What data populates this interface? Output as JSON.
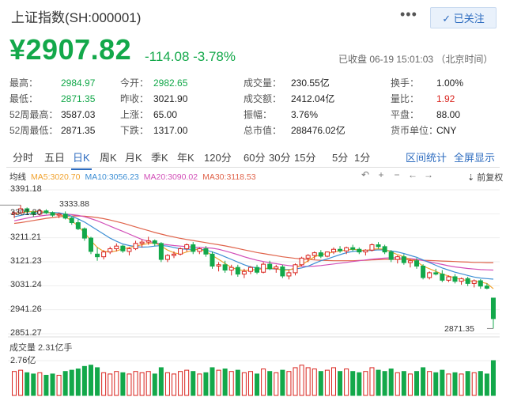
{
  "header": {
    "title": "上证指数(SH:000001)",
    "more_label": "•••",
    "follow_label": "✓ 已关注"
  },
  "quote": {
    "price": "¥2907.82",
    "change": "-114.08",
    "change_pct": "-3.78%",
    "status": "已收盘 06-19 15:01:03 （北京时间）"
  },
  "stats": [
    {
      "label": "最高：",
      "value": "2984.97",
      "tone": "green"
    },
    {
      "label": "今开：",
      "value": "2982.65",
      "tone": "green"
    },
    {
      "label": "成交量：",
      "value": "230.55亿",
      "tone": "default"
    },
    {
      "label": "换手：",
      "value": "1.00%",
      "tone": "default"
    },
    {
      "label": "最低：",
      "value": "2871.35",
      "tone": "green"
    },
    {
      "label": "昨收：",
      "value": "3021.90",
      "tone": "default"
    },
    {
      "label": "成交额：",
      "value": "2412.04亿",
      "tone": "default"
    },
    {
      "label": "量比：",
      "value": "1.92",
      "tone": "red"
    },
    {
      "label": "52周最高：",
      "value": "3587.03",
      "tone": "default"
    },
    {
      "label": "上涨：",
      "value": "65.00",
      "tone": "default"
    },
    {
      "label": "振幅：",
      "value": "3.76%",
      "tone": "default"
    },
    {
      "label": "平盘：",
      "value": "88.00",
      "tone": "default"
    },
    {
      "label": "52周最低：",
      "value": "2871.35",
      "tone": "default"
    },
    {
      "label": "下跌：",
      "value": "1317.00",
      "tone": "default"
    },
    {
      "label": "总市值：",
      "value": "288476.02亿",
      "tone": "default"
    },
    {
      "label": "货币单位：",
      "value": "CNY",
      "tone": "default"
    }
  ],
  "tabs": [
    "分时",
    "五日",
    "日K",
    "周K",
    "月K",
    "季K",
    "年K",
    "120分",
    "60分",
    "30分",
    "15分",
    "5分",
    "1分"
  ],
  "active_tab": "日K",
  "right_tabs": [
    "区间统计",
    "全屏显示"
  ],
  "ma_legend": [
    {
      "label": "均线",
      "color": "#333333"
    },
    {
      "label": "MA5:3020.70",
      "color": "#f0a22e"
    },
    {
      "label": "MA10:3056.23",
      "color": "#3c8ed4"
    },
    {
      "label": "MA20:3090.02",
      "color": "#d24fb8"
    },
    {
      "label": "MA30:3118.53",
      "color": "#e0634a"
    }
  ],
  "chart_controls": [
    "↶",
    "+",
    "−",
    "←",
    "→"
  ],
  "restore_label": "前复权",
  "chart_data": {
    "type": "candlestick",
    "y_ticks": [
      "3391.18",
      "3301.20",
      "3211.21",
      "3121.23",
      "3031.24",
      "2941.26",
      "2851.27"
    ],
    "ylim": [
      2851.27,
      3391.18
    ],
    "max_label": "3333.88",
    "min_label": "2871.35",
    "volume_title": "成交量 2.31亿手",
    "volume_max_label": "2.76亿",
    "up_color": "#d9241e",
    "down_color": "#13a84a",
    "candles": [
      [
        3300,
        3310,
        3285,
        3305
      ],
      [
        3305,
        3334,
        3300,
        3320
      ],
      [
        3320,
        3325,
        3300,
        3310
      ],
      [
        3308,
        3312,
        3290,
        3300
      ],
      [
        3300,
        3320,
        3295,
        3312
      ],
      [
        3312,
        3318,
        3300,
        3305
      ],
      [
        3305,
        3310,
        3290,
        3296
      ],
      [
        3296,
        3305,
        3285,
        3300
      ],
      [
        3300,
        3310,
        3280,
        3285
      ],
      [
        3285,
        3290,
        3260,
        3268
      ],
      [
        3268,
        3280,
        3240,
        3245
      ],
      [
        3245,
        3250,
        3200,
        3210
      ],
      [
        3210,
        3215,
        3150,
        3160
      ],
      [
        3150,
        3175,
        3125,
        3140
      ],
      [
        3140,
        3165,
        3130,
        3158
      ],
      [
        3158,
        3178,
        3150,
        3170
      ],
      [
        3170,
        3190,
        3160,
        3180
      ],
      [
        3180,
        3185,
        3155,
        3162
      ],
      [
        3160,
        3175,
        3145,
        3170
      ],
      [
        3170,
        3200,
        3165,
        3190
      ],
      [
        3190,
        3205,
        3175,
        3195
      ],
      [
        3195,
        3215,
        3185,
        3200
      ],
      [
        3200,
        3205,
        3180,
        3190
      ],
      [
        3190,
        3195,
        3120,
        3130
      ],
      [
        3130,
        3150,
        3120,
        3145
      ],
      [
        3145,
        3160,
        3135,
        3150
      ],
      [
        3150,
        3175,
        3145,
        3170
      ],
      [
        3170,
        3190,
        3160,
        3185
      ],
      [
        3185,
        3195,
        3150,
        3160
      ],
      [
        3160,
        3175,
        3150,
        3170
      ],
      [
        3170,
        3180,
        3140,
        3150
      ],
      [
        3150,
        3160,
        3095,
        3105
      ],
      [
        3105,
        3120,
        3085,
        3110
      ],
      [
        3110,
        3125,
        3080,
        3090
      ],
      [
        3090,
        3110,
        3070,
        3100
      ],
      [
        3100,
        3110,
        3065,
        3075
      ],
      [
        3075,
        3095,
        3060,
        3085
      ],
      [
        3085,
        3105,
        3075,
        3100
      ],
      [
        3100,
        3110,
        3075,
        3082
      ],
      [
        3082,
        3120,
        3078,
        3112
      ],
      [
        3112,
        3125,
        3090,
        3095
      ],
      [
        3095,
        3110,
        3080,
        3102
      ],
      [
        3102,
        3110,
        3060,
        3068
      ],
      [
        3068,
        3090,
        3055,
        3080
      ],
      [
        3080,
        3115,
        3070,
        3110
      ],
      [
        3110,
        3140,
        3105,
        3135
      ],
      [
        3135,
        3150,
        3120,
        3145
      ],
      [
        3145,
        3160,
        3130,
        3155
      ],
      [
        3155,
        3165,
        3135,
        3142
      ],
      [
        3142,
        3160,
        3138,
        3158
      ],
      [
        3158,
        3175,
        3150,
        3168
      ],
      [
        3168,
        3180,
        3155,
        3162
      ],
      [
        3162,
        3178,
        3150,
        3174
      ],
      [
        3174,
        3185,
        3160,
        3168
      ],
      [
        3168,
        3175,
        3150,
        3158
      ],
      [
        3158,
        3168,
        3145,
        3165
      ],
      [
        3165,
        3190,
        3160,
        3185
      ],
      [
        3185,
        3195,
        3170,
        3178
      ],
      [
        3178,
        3185,
        3150,
        3158
      ],
      [
        3158,
        3165,
        3120,
        3130
      ],
      [
        3130,
        3145,
        3115,
        3140
      ],
      [
        3140,
        3150,
        3110,
        3118
      ],
      [
        3118,
        3130,
        3100,
        3125
      ],
      [
        3125,
        3135,
        3095,
        3105
      ],
      [
        3105,
        3112,
        3055,
        3062
      ],
      [
        3062,
        3085,
        3055,
        3080
      ],
      [
        3080,
        3095,
        3070,
        3075
      ],
      [
        3075,
        3090,
        3045,
        3052
      ],
      [
        3052,
        3070,
        3045,
        3065
      ],
      [
        3065,
        3075,
        3040,
        3048
      ],
      [
        3048,
        3062,
        3035,
        3058
      ],
      [
        3058,
        3065,
        3030,
        3040
      ],
      [
        3040,
        3055,
        3025,
        3050
      ],
      [
        3050,
        3056,
        3020,
        3030
      ],
      [
        3030,
        3040,
        3018,
        3022
      ],
      [
        2985,
        2985,
        2871,
        2908
      ]
    ],
    "ma5": [
      3300,
      3306,
      3308,
      3310,
      3309,
      3307,
      3303,
      3299,
      3290,
      3275,
      3255,
      3230,
      3200,
      3175,
      3160,
      3158,
      3162,
      3170,
      3175,
      3180,
      3185,
      3190,
      3192,
      3180,
      3165,
      3155,
      3150,
      3158,
      3165,
      3168,
      3160,
      3145,
      3130,
      3115,
      3100,
      3092,
      3088,
      3090,
      3092,
      3095,
      3098,
      3095,
      3090,
      3090,
      3098,
      3110,
      3125,
      3140,
      3148,
      3152,
      3158,
      3162,
      3165,
      3168,
      3165,
      3163,
      3168,
      3170,
      3168,
      3158,
      3148,
      3140,
      3130,
      3122,
      3105,
      3095,
      3085,
      3075,
      3068,
      3060,
      3055,
      3050,
      3048,
      3045,
      3040,
      3020
    ],
    "ma10": [
      3290,
      3295,
      3300,
      3303,
      3305,
      3306,
      3306,
      3305,
      3300,
      3292,
      3282,
      3270,
      3255,
      3240,
      3225,
      3210,
      3198,
      3188,
      3182,
      3178,
      3176,
      3177,
      3180,
      3182,
      3180,
      3175,
      3170,
      3168,
      3168,
      3168,
      3165,
      3158,
      3150,
      3140,
      3130,
      3120,
      3110,
      3102,
      3098,
      3096,
      3095,
      3094,
      3092,
      3092,
      3094,
      3098,
      3105,
      3115,
      3125,
      3132,
      3140,
      3148,
      3155,
      3160,
      3162,
      3163,
      3164,
      3166,
      3165,
      3162,
      3158,
      3152,
      3145,
      3138,
      3128,
      3118,
      3108,
      3098,
      3090,
      3082,
      3076,
      3070,
      3064,
      3060,
      3058,
      3056
    ],
    "ma20": [
      3275,
      3280,
      3285,
      3290,
      3293,
      3296,
      3298,
      3300,
      3300,
      3298,
      3295,
      3290,
      3283,
      3275,
      3265,
      3255,
      3245,
      3235,
      3225,
      3215,
      3205,
      3198,
      3192,
      3188,
      3185,
      3182,
      3180,
      3178,
      3176,
      3175,
      3174,
      3172,
      3168,
      3162,
      3155,
      3148,
      3140,
      3133,
      3127,
      3122,
      3118,
      3114,
      3110,
      3107,
      3105,
      3104,
      3104,
      3105,
      3107,
      3110,
      3113,
      3116,
      3119,
      3122,
      3125,
      3128,
      3131,
      3133,
      3135,
      3136,
      3136,
      3135,
      3133,
      3130,
      3126,
      3121,
      3116,
      3111,
      3106,
      3102,
      3099,
      3096,
      3094,
      3092,
      3091,
      3090
    ],
    "ma30": [
      3265,
      3268,
      3272,
      3276,
      3280,
      3284,
      3287,
      3290,
      3292,
      3293,
      3293,
      3292,
      3290,
      3287,
      3283,
      3278,
      3272,
      3266,
      3259,
      3252,
      3245,
      3238,
      3231,
      3225,
      3219,
      3214,
      3209,
      3205,
      3201,
      3197,
      3193,
      3189,
      3185,
      3181,
      3176,
      3171,
      3166,
      3161,
      3156,
      3152,
      3148,
      3144,
      3140,
      3137,
      3134,
      3132,
      3130,
      3128,
      3127,
      3126,
      3125,
      3125,
      3125,
      3125,
      3126,
      3127,
      3128,
      3129,
      3130,
      3130,
      3130,
      3130,
      3129,
      3128,
      3127,
      3126,
      3125,
      3124,
      3123,
      3122,
      3121,
      3120,
      3119,
      3119,
      3118,
      3118
    ],
    "volume_ylim": [
      0,
      2.76
    ],
    "volumes": [
      1.9,
      2.0,
      1.8,
      1.7,
      1.8,
      1.6,
      1.7,
      1.6,
      1.9,
      2.0,
      2.1,
      2.3,
      2.4,
      2.2,
      1.8,
      1.7,
      1.9,
      1.8,
      1.7,
      1.9,
      1.8,
      1.9,
      1.7,
      2.2,
      1.8,
      1.7,
      1.9,
      2.0,
      1.9,
      1.7,
      1.8,
      2.2,
      2.0,
      2.1,
      1.9,
      2.0,
      1.8,
      1.9,
      1.7,
      2.1,
      1.9,
      1.8,
      2.0,
      1.9,
      2.2,
      2.4,
      2.2,
      2.1,
      1.9,
      2.0,
      2.2,
      1.9,
      2.1,
      1.9,
      1.8,
      1.9,
      2.2,
      2.0,
      1.9,
      2.1,
      1.8,
      1.9,
      1.7,
      1.9,
      2.2,
      1.9,
      1.8,
      2.0,
      1.7,
      1.8,
      1.7,
      1.9,
      1.8,
      1.9,
      1.7,
      2.76
    ]
  }
}
